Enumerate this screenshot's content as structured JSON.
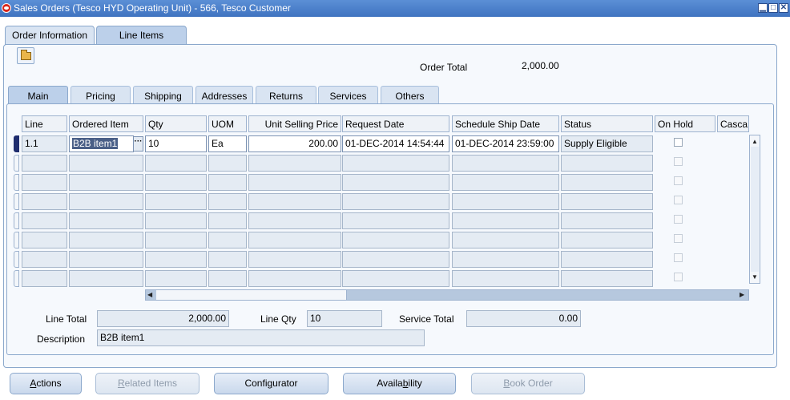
{
  "window": {
    "title": "Sales Orders (Tesco HYD Operating Unit) - 566, Tesco Customer",
    "minimize": "▁",
    "maximize": "□",
    "close": "✕"
  },
  "top_tabs": [
    {
      "label": "Order Information"
    },
    {
      "label": "Line Items"
    }
  ],
  "order_total": {
    "label": "Order Total",
    "value": "2,000.00"
  },
  "inner_tabs": [
    {
      "label": "Main"
    },
    {
      "label": "Pricing"
    },
    {
      "label": "Shipping"
    },
    {
      "label": "Addresses"
    },
    {
      "label": "Returns"
    },
    {
      "label": "Services"
    },
    {
      "label": "Others"
    }
  ],
  "grid": {
    "columns": {
      "line": "Line",
      "ordered_item": "Ordered Item",
      "qty": "Qty",
      "uom": "UOM",
      "unit_selling_price": "Unit Selling Price",
      "request_date": "Request Date",
      "schedule_ship_date": "Schedule Ship Date",
      "status": "Status",
      "on_hold": "On Hold",
      "cascade": "Casca"
    },
    "row1": {
      "line": "1.1",
      "ordered_item": "B2B item1",
      "lov": "···",
      "qty": "10",
      "uom": "Ea",
      "unit_selling_price": "200.00",
      "request_date": "01-DEC-2014 14:54:44",
      "schedule_ship_date": "01-DEC-2014 23:59:00",
      "status": "Supply Eligible"
    },
    "scroll_up": "▲",
    "scroll_down": "▼",
    "scroll_left": "◀",
    "scroll_right": "▶"
  },
  "totals": {
    "line_total_label": "Line Total",
    "line_total_value": "2,000.00",
    "line_qty_label": "Line Qty",
    "line_qty_value": "10",
    "service_total_label": "Service Total",
    "service_total_value": "0.00",
    "description_label": "Description",
    "description_value": "B2B item1"
  },
  "buttons": {
    "actions_pre": "",
    "actions_key": "A",
    "actions_post": "ctions",
    "related_pre": "",
    "related_key": "R",
    "related_post": "elated Items",
    "configurator_pre": "Confi",
    "configurator_key": "g",
    "configurator_post": "urator",
    "availability_pre": "Availa",
    "availability_key": "b",
    "availability_post": "ility",
    "book_pre": "",
    "book_key": "B",
    "book_post": "ook Order"
  },
  "colors": {
    "title_bar": "#3f73c0",
    "active_tab": "#bcd0ea",
    "selected_text_bg": "#4a5f87",
    "current_row_marker": "#1f2d6e"
  }
}
